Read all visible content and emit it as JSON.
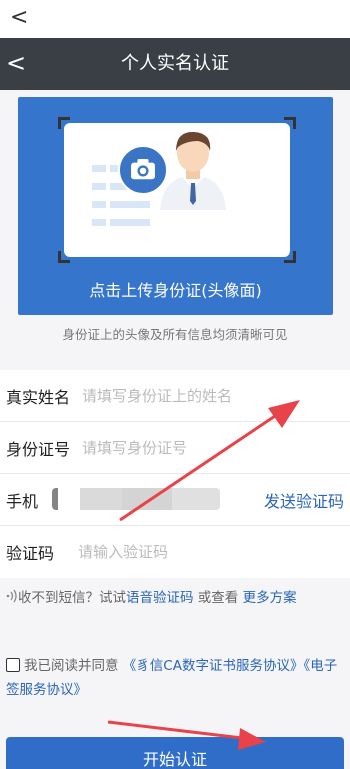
{
  "sysbar": {
    "back_glyph": "<"
  },
  "navbar": {
    "back_glyph": "<",
    "title": "个人实名认证"
  },
  "upload": {
    "label": "点击上传身份证(头像面)",
    "hint": "身份证上的头像及所有信息均须清晰可见"
  },
  "form": {
    "name": {
      "label": "真实姓名",
      "placeholder": "请填写身份证上的姓名"
    },
    "id": {
      "label": "身份证号",
      "placeholder": "请填写身份证号"
    },
    "phone": {
      "label": "手机",
      "send_code": "发送验证码"
    },
    "code": {
      "label": "验证码",
      "placeholder": "请输入验证码"
    }
  },
  "sms_help": {
    "prefix": "收不到短信？试试",
    "voice_link": "语音验证码",
    "middle": " 或查看 ",
    "more_link": "更多方案"
  },
  "agreement": {
    "checked": false,
    "prefix": "我已阅读并同意 ",
    "link1": "《豸信CA数字证书服务协议》",
    "link2": "《电子签服务协议》"
  },
  "start_button": "开始认证",
  "colors": {
    "primary": "#3575cc",
    "link": "#2a65b8",
    "annotation_arrow": "#e8424a",
    "navbar": "#3a3f45"
  },
  "icons": [
    "back-icon",
    "camera-icon",
    "avatar-icon",
    "sound-icon",
    "checkbox-icon"
  ]
}
